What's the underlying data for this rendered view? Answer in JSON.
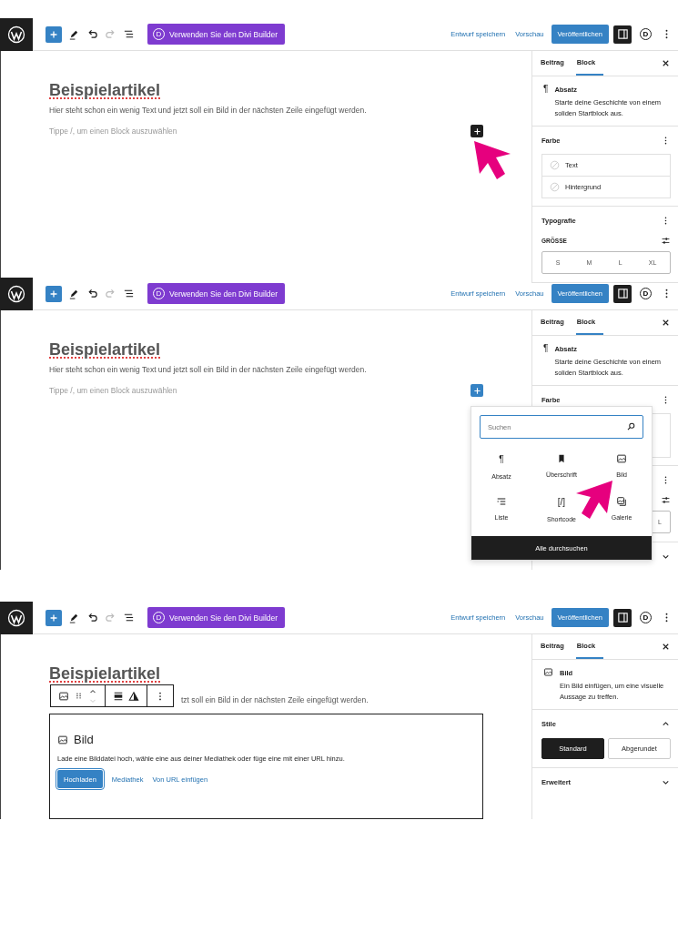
{
  "screens": [
    {
      "header": {
        "divi_letter": "D",
        "divi_label": "Verwenden Sie den Divi Builder",
        "save_draft": "Entwurf speichern",
        "preview": "Vorschau",
        "publish": "Veröffentlichen",
        "settings_pressed": true,
        "account_letter": "D"
      },
      "editor": {
        "title": "Beispielartikel",
        "paragraph": "Hier steht schon ein wenig Text und jetzt soll ein Bild in der nächsten Zeile eingefügt werden.",
        "placeholder": "Tippe /, um einen Block auszuwählen",
        "inserter": {
          "active": false,
          "pointed": true
        }
      },
      "sidebar": {
        "tabs": [
          {
            "label": "Beitrag",
            "selected": false
          },
          {
            "label": "Block",
            "selected": true
          }
        ],
        "block": {
          "kind": "glyph",
          "glyph": "¶",
          "name": "Absatz",
          "description": "Starte deine Geschichte von einem soliden Startblock aus."
        },
        "sections": [
          {
            "kind": "color",
            "title": "Farbe",
            "items": [
              {
                "label": "Text"
              },
              {
                "label": "Hintergrund"
              }
            ]
          },
          {
            "kind": "typography",
            "title": "Typografie",
            "size_label": "GRÖSSE",
            "sizes": [
              "S",
              "M",
              "L",
              "XL"
            ]
          }
        ]
      }
    },
    {
      "header": {
        "divi_letter": "D",
        "divi_label": "Verwenden Sie den Divi Builder",
        "save_draft": "Entwurf speichern",
        "preview": "Vorschau",
        "publish": "Veröffentlichen",
        "settings_pressed": true,
        "account_letter": "D"
      },
      "editor": {
        "title": "Beispielartikel",
        "paragraph": "Hier steht schon ein wenig Text und jetzt soll ein Bild in der nächsten Zeile eingefügt werden.",
        "placeholder": "Tippe /, um einen Block auszuwählen",
        "inserter": {
          "active": true,
          "pointed": false,
          "popup": {
            "search_placeholder": "Suchen",
            "browse_all": "Alle durchsuchen",
            "items": [
              {
                "kind": "glyph",
                "glyph": "¶",
                "label": "Absatz"
              },
              {
                "kind": "bookmark",
                "label": "Überschrift"
              },
              {
                "kind": "image",
                "label": "Bild",
                "pointed": true
              },
              {
                "kind": "list",
                "label": "Liste"
              },
              {
                "kind": "glyph",
                "glyph": "[/]",
                "label": "Shortcode"
              },
              {
                "kind": "gallery",
                "label": "Galerie"
              }
            ]
          }
        }
      },
      "sidebar": {
        "tabs": [
          {
            "label": "Beitrag",
            "selected": false
          },
          {
            "label": "Block",
            "selected": true
          }
        ],
        "block": {
          "kind": "glyph",
          "glyph": "¶",
          "name": "Absatz",
          "description": "Starte deine Geschichte von einem soliden Startblock aus."
        },
        "sections": [
          {
            "kind": "color",
            "title": "Farbe"
          },
          {
            "kind": "typography",
            "sizes": [
              "L"
            ]
          },
          {
            "kind": "collapsible",
            "expanded": false
          }
        ]
      }
    },
    {
      "header": {
        "divi_letter": "D",
        "divi_label": "Verwenden Sie den Divi Builder",
        "save_draft": "Entwurf speichern",
        "preview": "Vorschau",
        "publish": "Veröffentlichen",
        "settings_pressed": true,
        "account_letter": "D"
      },
      "editor": {
        "title": "Beispielartikel",
        "paragraph": "tzt soll ein Bild in der nächsten Zeile eingefügt werden.",
        "block_toolbar": {
          "can_move_down": false
        },
        "image_block": {
          "title": "Bild",
          "instructions": "Lade eine Bilddatei hoch, wähle eine aus deiner Mediathek oder füge eine mit einer URL hinzu.",
          "buttons": [
            {
              "label": "Hochladen",
              "kind": "primary"
            },
            {
              "label": "Mediathek",
              "kind": "link"
            },
            {
              "label": "Von URL einfügen",
              "kind": "link"
            }
          ]
        }
      },
      "sidebar": {
        "tabs": [
          {
            "label": "Beitrag",
            "selected": false
          },
          {
            "label": "Block",
            "selected": true
          }
        ],
        "block": {
          "kind": "image",
          "name": "Bild",
          "description": "Ein Bild einfügen, um eine visuelle Aussage zu treffen."
        },
        "sections": [
          {
            "kind": "styles",
            "title": "Stile",
            "expanded": true,
            "options": [
              {
                "label": "Standard",
                "selected": true
              },
              {
                "label": "Abgerundet",
                "selected": false
              }
            ]
          },
          {
            "kind": "collapsible",
            "title": "Erweitert",
            "expanded": false
          }
        ]
      }
    }
  ]
}
